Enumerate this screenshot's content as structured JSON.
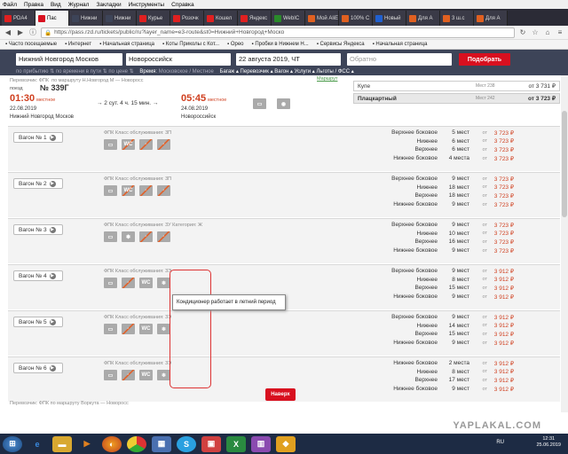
{
  "menu": [
    "Файл",
    "Правка",
    "Вид",
    "Журнал",
    "Закладки",
    "Инструменты",
    "Справка"
  ],
  "tabs": [
    {
      "label": "PDA4",
      "color": "#e02020"
    },
    {
      "label": "Пас",
      "color": "#d8101f"
    },
    {
      "label": "Нижни",
      "color": "#3d4458"
    },
    {
      "label": "Нижни",
      "color": "#3d4458"
    },
    {
      "label": "Курье",
      "color": "#e02020"
    },
    {
      "label": "Розочк",
      "color": "#e02020"
    },
    {
      "label": "Кошел",
      "color": "#e02020"
    },
    {
      "label": "Яндекс",
      "color": "#e02020"
    },
    {
      "label": "WebIC",
      "color": "#2a8a2a"
    },
    {
      "label": "Мой AliEx",
      "color": "#e06020"
    },
    {
      "label": "100% C",
      "color": "#e06020"
    },
    {
      "label": "Новый",
      "color": "#2060d0"
    },
    {
      "label": "Для А",
      "color": "#e06020"
    },
    {
      "label": "3 ш.с",
      "color": "#e06020"
    },
    {
      "label": "Для А",
      "color": "#e06020"
    }
  ],
  "url": "https://pass.rzd.ru/tickets/public/ru?layer_name=e3-route&st0=Нижний+Новгород+Моско",
  "bookmarks": [
    "Часто посещаемые",
    "Интернет",
    "Начальная страница",
    "Коты Приколы с Кот...",
    "Орео",
    "Пробки в Нижнем Н...",
    "Сервисы Яндекса",
    "Начальная страница"
  ],
  "search": {
    "from": "Нижний Новгород Москов",
    "to": "Новороссийск",
    "date": "22 августа 2019, ЧТ",
    "back": "Обратно",
    "button": "Подобрать",
    "filters": "по прибытию ⇅ по времени в пути ⇅ по цене ⇅",
    "time_label": "Время:",
    "time_val": "Московское / Местное",
    "options": "Багаж ▴  Перевозчик ▴  Вагон ▴  Услуги ▴  Льготы / ФСС ▴"
  },
  "train": {
    "carrier": "Перевозчик: ФПК",
    "route": "по маршруту Н.Новгород М — Новоросс",
    "type_label": "поезд",
    "number": "№ 339Г",
    "dep_time": "01:30",
    "dep_note": "местное",
    "dep_date": "22.08.2019",
    "dep_station": "Нижний Новгород Москов",
    "duration": "→ 2 сут. 4 ч. 15 мин. →",
    "arr_time": "05:45",
    "arr_note": "местное",
    "arr_date": "24.08.2019",
    "arr_station": "Новороссийск",
    "route_link": "Маршрут",
    "kupe": "Купе",
    "kupe_places": "Мест 238",
    "kupe_price": "от  3 731 ₽",
    "plac": "Плацкартный",
    "plac_places": "Мест 242",
    "plac_price": "от  3 723 ₽"
  },
  "wagons": [
    {
      "label": "Вагон № 1",
      "class": "ФПК   Класс обслуживания: 3П",
      "seats": [
        [
          "Верхнее боковое",
          "5 мест",
          "3 723 ₽"
        ],
        [
          "Нижнее",
          "6 мест",
          "3 723 ₽"
        ],
        [
          "Верхнее",
          "6 мест",
          "3 723 ₽"
        ],
        [
          "Нижнее боковое",
          "4 места",
          "3 723 ₽"
        ]
      ]
    },
    {
      "label": "Вагон № 2",
      "class": "ФПК   Класс обслуживания: 3П",
      "seats": [
        [
          "Верхнее боковое",
          "9 мест",
          "3 723 ₽"
        ],
        [
          "Нижнее",
          "18 мест",
          "3 723 ₽"
        ],
        [
          "Верхнее",
          "18 мест",
          "3 723 ₽"
        ],
        [
          "Нижнее боковое",
          "9 мест",
          "3 723 ₽"
        ]
      ]
    },
    {
      "label": "Вагон № 3",
      "class": "ФПК   Класс обслуживания: 3У   Категория: Ж",
      "seats": [
        [
          "Верхнее боковое",
          "9 мест",
          "3 723 ₽"
        ],
        [
          "Нижнее",
          "10 мест",
          "3 723 ₽"
        ],
        [
          "Верхнее",
          "16 мест",
          "3 723 ₽"
        ],
        [
          "Нижнее боковое",
          "9 мест",
          "3 723 ₽"
        ]
      ]
    },
    {
      "label": "Вагон № 4",
      "class": "ФПК   Класс обслуживания: 3Э",
      "seats": [
        [
          "Верхнее боковое",
          "9 мест",
          "3 912 ₽"
        ],
        [
          "Нижнее",
          "8 мест",
          "3 912 ₽"
        ],
        [
          "Верхнее",
          "15 мест",
          "3 912 ₽"
        ],
        [
          "Нижнее боковое",
          "9 мест",
          "3 912 ₽"
        ]
      ]
    },
    {
      "label": "Вагон № 5",
      "class": "ФПК   Класс обслуживания: 3Э",
      "seats": [
        [
          "Верхнее боковое",
          "9 мест",
          "3 912 ₽"
        ],
        [
          "Нижнее",
          "14 мест",
          "3 912 ₽"
        ],
        [
          "Верхнее",
          "15 мест",
          "3 912 ₽"
        ],
        [
          "Нижнее боковое",
          "9 мест",
          "3 912 ₽"
        ]
      ]
    },
    {
      "label": "Вагон № 6",
      "class": "ФПК   Класс обслуживания: 3Э",
      "seats": [
        [
          "Нижнее боковое",
          "2 места",
          "3 912 ₽"
        ],
        [
          "Нижнее",
          "8 мест",
          "3 912 ₽"
        ],
        [
          "Верхнее",
          "17 мест",
          "3 912 ₽"
        ],
        [
          "Нижнее боковое",
          "9 мест",
          "3 912 ₽"
        ]
      ]
    }
  ],
  "from_label": "от",
  "tooltip": "Кондиционер работает в летний период",
  "up_button": "Наверх",
  "next_train": "Перевозчик: ФПК   по маршруту Воркута — Новоросс",
  "watermark": "YAPLAKAL.COM",
  "tray": {
    "lang": "RU",
    "time": "12:31",
    "date": "25.06.2019"
  }
}
